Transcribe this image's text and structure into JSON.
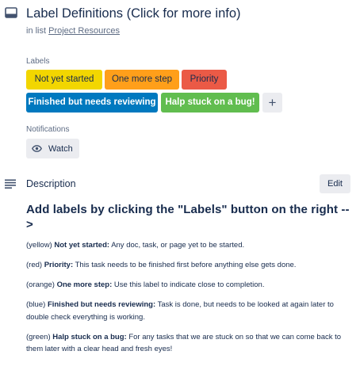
{
  "card": {
    "title": "Label Definitions (Click for more info)",
    "in_list_prefix": "in list",
    "list_name": "Project Resources"
  },
  "labels": {
    "heading": "Labels",
    "items": [
      {
        "text": "Not yet started",
        "color": "#f2d600"
      },
      {
        "text": "One more step",
        "color": "#ff9f1a"
      },
      {
        "text": "Priority",
        "color": "#eb5a46"
      },
      {
        "text": "Finished but needs reviewing",
        "color": "#0079bf"
      },
      {
        "text": "Halp stuck on a bug!",
        "color": "#61bd4f"
      }
    ],
    "add_symbol": "+"
  },
  "notifications": {
    "heading": "Notifications",
    "watch_label": "Watch"
  },
  "description": {
    "heading": "Description",
    "edit_label": "Edit",
    "title": "Add labels by clicking the \"Labels\" button on the right -->",
    "entries": [
      {
        "color_word": "(yellow)",
        "name": "Not yet started:",
        "text": "Any doc, task, or page yet to be started."
      },
      {
        "color_word": "(red)",
        "name": "Priority:",
        "text": "This task needs to be finished first before anything else gets done."
      },
      {
        "color_word": "(orange)",
        "name": "One more step:",
        "text": "Use this label to indicate close to completion."
      },
      {
        "color_word": "(blue)",
        "name": "Finished but needs reviewing:",
        "text": "Task is done, but needs to be looked at again later to double check everything is working."
      },
      {
        "color_word": "(green)",
        "name": "Halp stuck on a bug:",
        "text": "For any tasks that we are stuck on so that we can come back to them later with a clear head and fresh eyes!"
      }
    ]
  },
  "icons": {
    "card": "card-icon",
    "watch": "eye-icon",
    "description": "description-lines-icon",
    "add": "plus-icon"
  }
}
